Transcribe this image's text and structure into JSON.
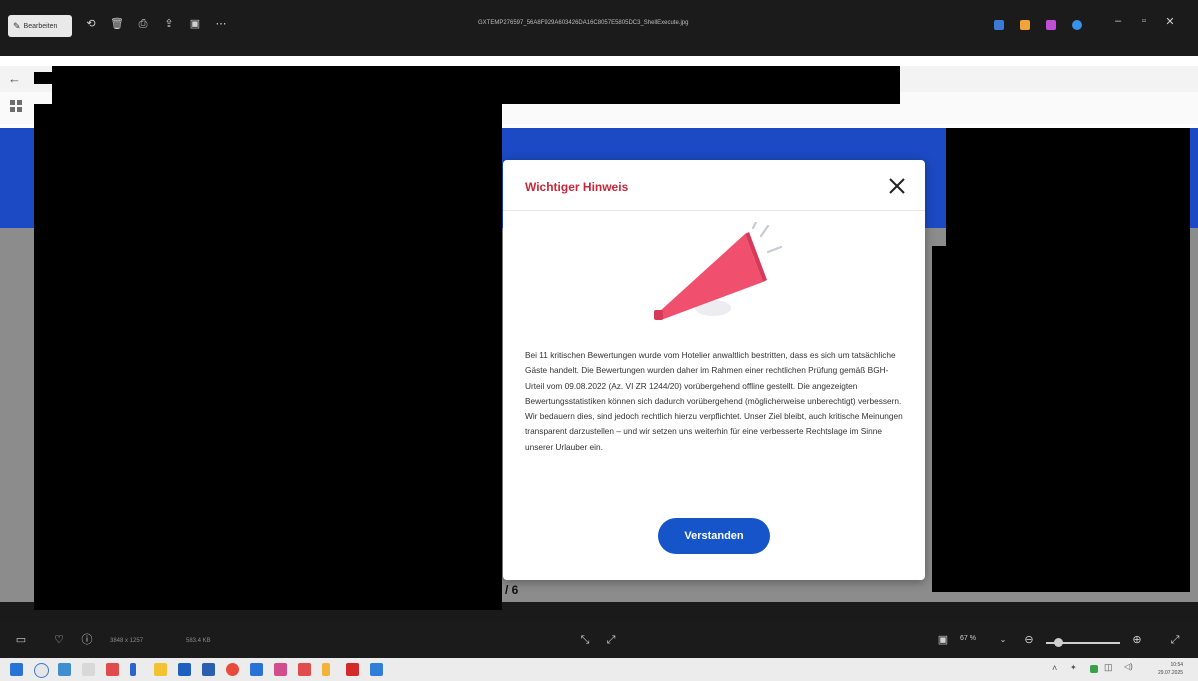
{
  "viewer": {
    "edit_label": "Bearbeiten",
    "filename": "GXTEMP276597_56A8F929A603426DA16C8057E5805DC3_ShellExecute.jpg",
    "image_info": "3848 x 1257",
    "file_size": "583.4 KB",
    "zoom": "67 %",
    "page_count": "/ 6"
  },
  "modal": {
    "title": "Wichtiger Hinweis",
    "body": "Bei 11 kritischen Bewertungen wurde vom Hotelier anwaltlich bestritten, dass es sich um tatsächliche Gäste handelt. Die Bewertungen wurden daher im Rahmen einer rechtlichen Prüfung gemäß BGH-Urteil vom 09.08.2022 (Az. VI ZR 1244/20) vorübergehend offline gestellt. Die angezeigten Bewertungsstatistiken können sich dadurch vorübergehend (möglicherweise unberechtigt) verbessern. Wir bedauern dies, sind jedoch rechtlich hierzu verpflichtet. Unser Ziel bleibt, auch kritische Meinungen transparent darzustellen – und wir setzen uns weiterhin für eine verbesserte Rechtslage im Sinne unserer Urlauber ein.",
    "button": "Verstanden"
  },
  "taskbar": {
    "time": "10:54",
    "date": "29.07.2025"
  },
  "colors": {
    "accent_red": "#c6283a",
    "button_blue": "#1555c9",
    "site_blue": "#1b4ac4",
    "megaphone_pink": "#f0506e"
  }
}
